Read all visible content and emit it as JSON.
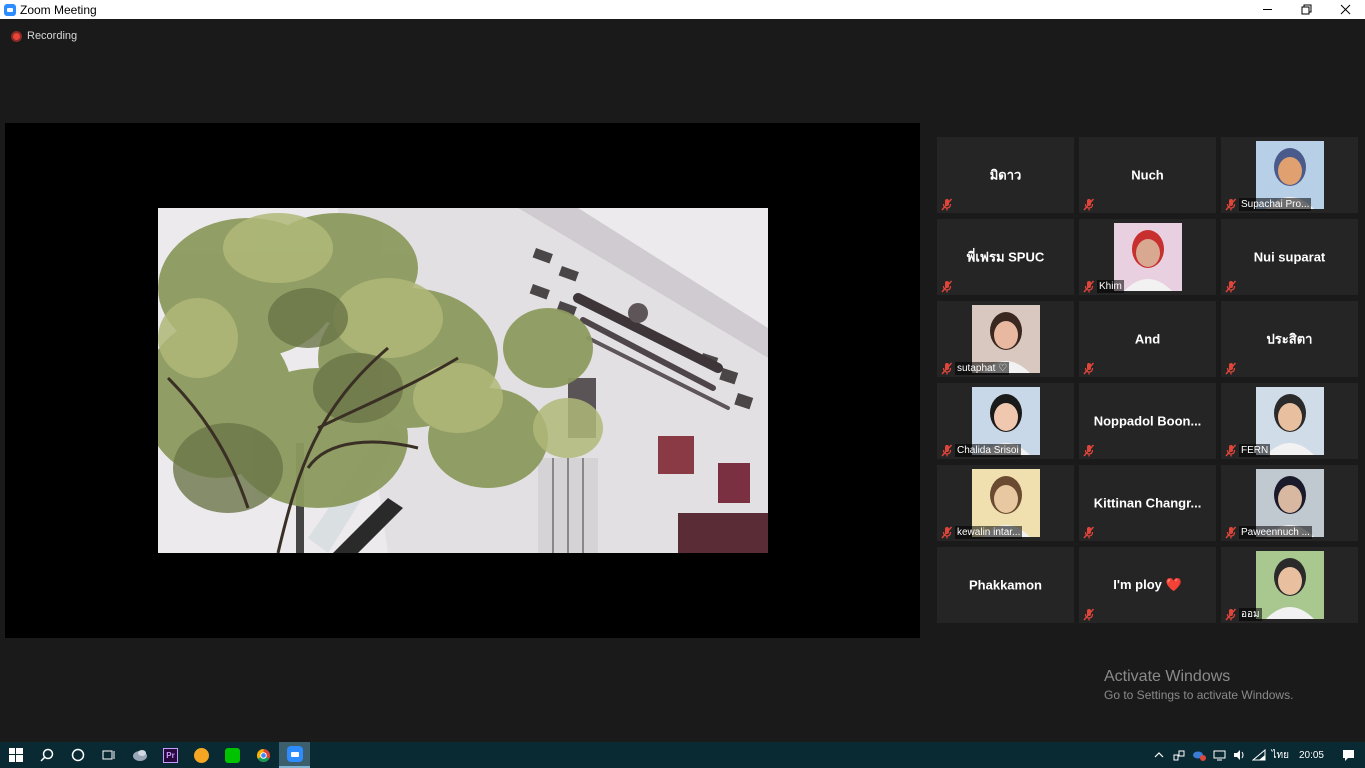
{
  "window": {
    "title": "Zoom Meeting",
    "minimize_icon": "minimize-icon",
    "restore_icon": "restore-icon",
    "close_icon": "close-icon"
  },
  "recording": {
    "label": "Recording"
  },
  "participants": [
    {
      "name": "มิดาว",
      "has_video": false,
      "muted": true
    },
    {
      "name": "Nuch",
      "has_video": false,
      "muted": true
    },
    {
      "name": "Supachai Pro...",
      "has_video": true,
      "muted": true
    },
    {
      "name": "พี่เฟรม SPUC",
      "has_video": false,
      "muted": true
    },
    {
      "name": "Khim",
      "has_video": true,
      "muted": true
    },
    {
      "name": "Nui suparat",
      "has_video": false,
      "muted": true
    },
    {
      "name": "sutaphat ♡",
      "has_video": true,
      "muted": true
    },
    {
      "name": "And",
      "has_video": false,
      "muted": true
    },
    {
      "name": "ประสิตา",
      "has_video": false,
      "muted": true
    },
    {
      "name": "Chalida Srisoi",
      "has_video": true,
      "muted": true
    },
    {
      "name": "Noppadol Boon...",
      "has_video": false,
      "muted": true
    },
    {
      "name": "FERN",
      "has_video": true,
      "muted": true
    },
    {
      "name": "kewalin intar...",
      "has_video": true,
      "muted": true
    },
    {
      "name": "Kittinan Changr...",
      "has_video": false,
      "muted": true
    },
    {
      "name": "Paweennuch ...",
      "has_video": true,
      "muted": true
    },
    {
      "name": "Phakkamon",
      "has_video": false,
      "muted": false
    },
    {
      "name": "I'm ploy ❤️",
      "has_video": false,
      "muted": true
    },
    {
      "name": "ออม",
      "has_video": true,
      "muted": true
    }
  ],
  "watermark": {
    "line1": "Activate Windows",
    "line2": "Go to Settings to activate Windows."
  },
  "taskbar": {
    "items": [
      "windows-start-icon",
      "search-icon",
      "cortana-icon",
      "task-view-icon",
      "app-icon",
      "premiere-icon",
      "browser-icon",
      "line-icon",
      "chrome-icon",
      "zoom-icon"
    ],
    "premiere_label": "Pr",
    "language": "ไทย",
    "time": "20:05"
  },
  "colors": {
    "background": "#1a1a1a",
    "tile": "#252525",
    "mute_red": "#e0453a",
    "taskbar": "#0a2a33",
    "zoom_blue": "#2d8cff"
  }
}
